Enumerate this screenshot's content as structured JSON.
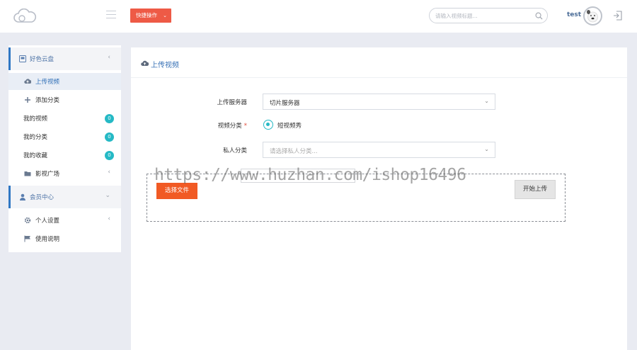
{
  "header": {
    "quick_action_label": "快捷操作",
    "search_placeholder": "请输入视频标题...",
    "username": "test"
  },
  "sidebar": {
    "groups": [
      {
        "label": "好色云盘",
        "items": [
          {
            "label": "上传视频",
            "icon": "cloud-upload-icon",
            "active": true
          },
          {
            "label": "添加分类",
            "icon": "plus-icon"
          },
          {
            "label": "我的视频",
            "badge": "0"
          },
          {
            "label": "我的分类",
            "badge": "0"
          },
          {
            "label": "我的收藏",
            "badge": "0"
          },
          {
            "label": "影视广场",
            "icon": "folder-icon"
          }
        ]
      },
      {
        "label": "会员中心",
        "items": [
          {
            "label": "个人设置",
            "icon": "gear-icon"
          },
          {
            "label": "使用说明",
            "icon": "flag-icon"
          }
        ]
      }
    ]
  },
  "main": {
    "title": "上传视频",
    "form": {
      "server_label": "上传服务器",
      "server_value": "切片服务器",
      "category_label": "视频分类",
      "category_option": "短视频秀",
      "private_label": "私人分类",
      "private_placeholder": "请选择私人分类..."
    },
    "choose_file_label": "选择文件",
    "start_upload_label": "开始上传"
  },
  "watermark": "https://www.huzhan.com/ishop16496",
  "colors": {
    "accent_blue": "#2f77c4",
    "quick_btn": "#ee5a46",
    "badge_teal": "#25b9c5",
    "choose_btn": "#f15a24",
    "bg": "#e9ebf2"
  }
}
